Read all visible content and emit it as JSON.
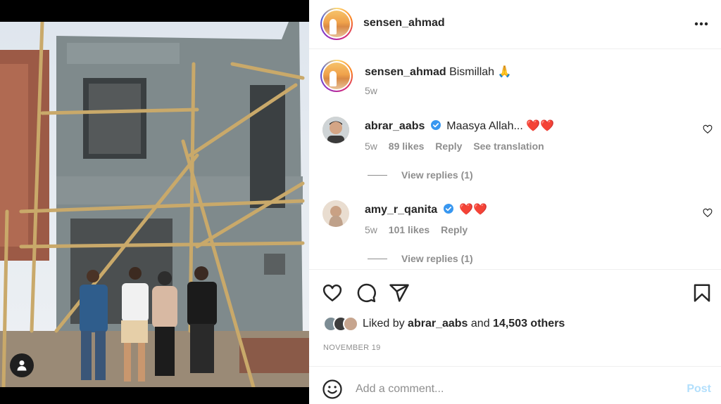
{
  "post": {
    "username": "sensen_ahmad",
    "more_icon": "more-horizontal-icon"
  },
  "caption": {
    "username": "sensen_ahmad",
    "text": "Bismillah",
    "emoji": "🙏",
    "time": "5w"
  },
  "comments": [
    {
      "username": "abrar_aabs",
      "verified": true,
      "text": "Maasya Allah...",
      "hearts": "❤️❤️",
      "time": "5w",
      "likes": "89 likes",
      "reply": "Reply",
      "translate": "See translation",
      "view_replies": "View replies (1)"
    },
    {
      "username": "amy_r_qanita",
      "verified": true,
      "text": "",
      "hearts": "❤️❤️",
      "time": "5w",
      "likes": "101 likes",
      "reply": "Reply",
      "view_replies": "View replies (1)"
    }
  ],
  "likes": {
    "prefix": "Liked by",
    "user": "abrar_aabs",
    "and": "and",
    "others": "14,503 others"
  },
  "date": "NOVEMBER 19",
  "composer": {
    "placeholder": "Add a comment...",
    "post_label": "Post"
  },
  "colors": {
    "verified": "#3897f0",
    "heart": "#ed4956",
    "post_disabled": "#b2dffc"
  }
}
